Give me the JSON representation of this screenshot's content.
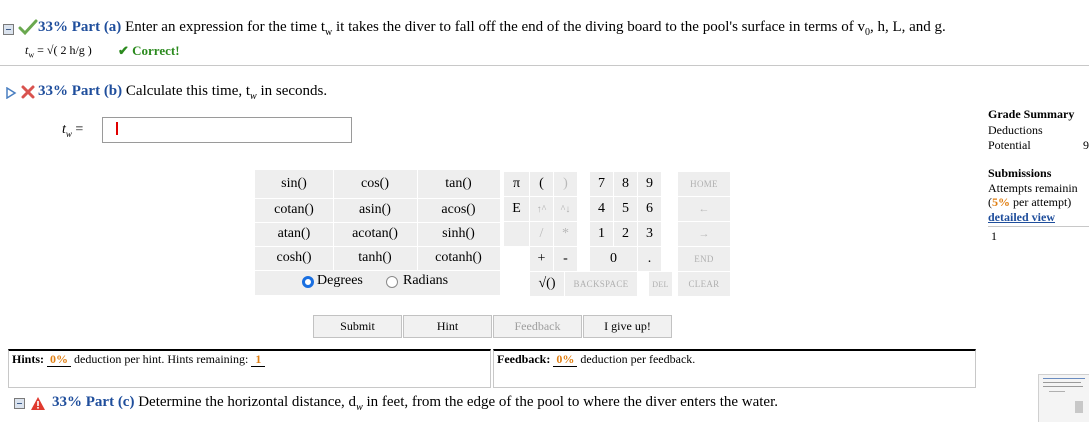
{
  "part_a": {
    "percent": "33%",
    "label": "Part (a)",
    "question": "Enter an expression for the time t",
    "sub_w": "w",
    "question_rest": " it takes the diver to fall off the end of the diving board to the pool's surface in terms of v",
    "sub_0": "0",
    "question_tail": ", h, L, and g.",
    "answer": "t",
    "answer_sub": "w",
    "answer_expr": " = √( 2 h/g )",
    "status": "✔ Correct!"
  },
  "part_b": {
    "percent": "33%",
    "label": "Part (b)",
    "question": "Calculate this time, t",
    "sub_w": "w",
    "question_tail": " in seconds.",
    "input_label": "t",
    "input_sub": "w",
    "input_eq": " =",
    "input_value": ""
  },
  "functions": [
    [
      "sin()",
      "cos()",
      "tan()"
    ],
    [
      "cotan()",
      "asin()",
      "acos()"
    ],
    [
      "atan()",
      "acotan()",
      "sinh()"
    ],
    [
      "cosh()",
      "tanh()",
      "cotanh()"
    ]
  ],
  "angle_mode": {
    "degrees": "Degrees",
    "radians": "Radians",
    "selected": "degrees"
  },
  "keypad": {
    "pi": "π",
    "lparen": "(",
    "rparen": ")",
    "e": "E",
    "up": "↑^",
    "down": "^↓",
    "div": "/",
    "mul": "*",
    "plus": "+",
    "minus": "-",
    "sqrt": "√()",
    "digits_row1": [
      "7",
      "8",
      "9"
    ],
    "digits_row2": [
      "4",
      "5",
      "6"
    ],
    "digits_row3": [
      "1",
      "2",
      "3"
    ],
    "zero": "0",
    "dot": ".",
    "home": "HOME",
    "left": "←",
    "right": "→",
    "end": "END",
    "backspace": "BACKSPACE",
    "del": "DEL",
    "clear": "CLEAR"
  },
  "actions": {
    "submit": "Submit",
    "hint": "Hint",
    "feedback": "Feedback",
    "give_up": "I give up!"
  },
  "hints": {
    "label": "Hints:",
    "percent": "0%",
    "text": "deduction per hint. Hints remaining:",
    "remaining": "1"
  },
  "feedback": {
    "label": "Feedback:",
    "percent": "0%",
    "text": "deduction per feedback."
  },
  "part_c": {
    "percent": "33%",
    "label": "Part (c)",
    "question": "Determine the horizontal distance, d",
    "sub_w": "w",
    "question_tail": " in feet, from the edge of the pool to where the diver enters the water."
  },
  "sidebar": {
    "grade_summary": "Grade Summary",
    "deductions": "Deductions",
    "potential": "Potential",
    "potential_value_fragment": "9",
    "submissions": "Submissions",
    "attempts": "Attempts remainin",
    "per_attempt_pct": "5%",
    "per_attempt_text": " per attempt)",
    "per_attempt_open": "(",
    "detailed_view": "detailed view",
    "row_value": "1"
  },
  "colors": {
    "accent": "#1f4e9c",
    "orange": "#e07f13",
    "correct": "#2b8a1e",
    "error": "#e00000"
  }
}
